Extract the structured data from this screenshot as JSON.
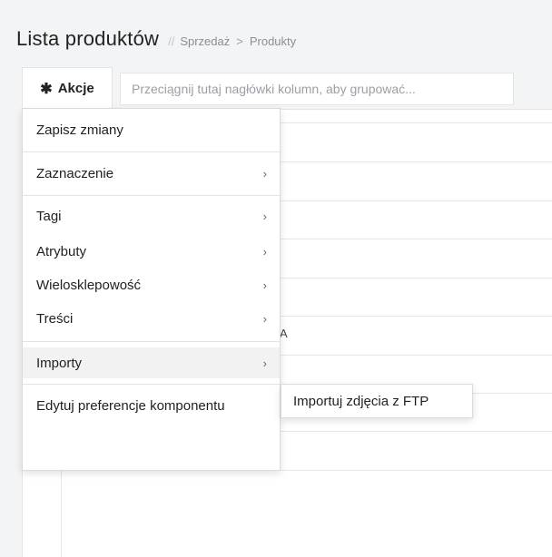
{
  "header": {
    "title": "Lista produktów",
    "breadcrumb_separator": "//",
    "breadcrumb": [
      "Sprzedaż",
      "Produkty"
    ],
    "breadcrumb_arrow": ">"
  },
  "toolbar": {
    "actions_icon": "✱",
    "actions_label": "Akcje",
    "group_placeholder": "Przeciągnij tutaj nagłówki kolumn, aby grupować..."
  },
  "grid": {
    "visible_fragment": "A"
  },
  "menu": {
    "save_changes": "Zapisz zmiany",
    "selection": "Zaznaczenie",
    "tags": "Tagi",
    "attributes": "Atrybuty",
    "multistore": "Wielosklepowość",
    "contents": "Treści",
    "imports": "Importy",
    "edit_preferences": "Edytuj preferencje komponentu",
    "submenu_arrow": "›"
  },
  "submenu": {
    "import_photos_ftp": "Importuj zdjęcia z FTP"
  },
  "colors": {
    "page_background": "#f3f4f5",
    "menu_highlight": "#f2f2f2",
    "border": "#e2e4e6"
  }
}
